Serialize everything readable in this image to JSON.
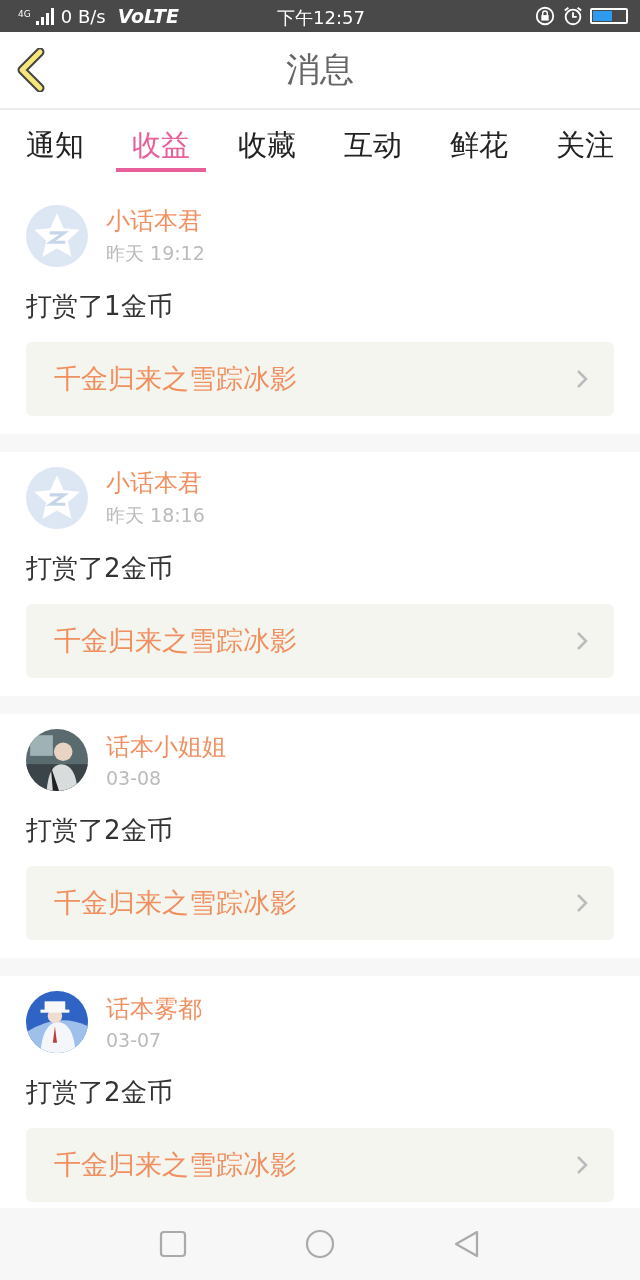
{
  "status_bar": {
    "network": "4G",
    "speed": "0 B/s",
    "volte": "VoLTE",
    "time": "下午12:57"
  },
  "header": {
    "title": "消息"
  },
  "tabs": [
    {
      "label": "通知",
      "selected": false
    },
    {
      "label": "收益",
      "selected": true
    },
    {
      "label": "收藏",
      "selected": false
    },
    {
      "label": "互动",
      "selected": false
    },
    {
      "label": "鲜花",
      "selected": false
    },
    {
      "label": "关注",
      "selected": false
    }
  ],
  "messages": [
    {
      "avatar": {
        "kind": "default"
      },
      "user": "小话本君",
      "time": "昨天 19:12",
      "text": "打赏了1金币",
      "book": "千金归来之雪踪冰影"
    },
    {
      "avatar": {
        "kind": "default"
      },
      "user": "小话本君",
      "time": "昨天 18:16",
      "text": "打赏了2金币",
      "book": "千金归来之雪踪冰影"
    },
    {
      "user": "话本小姐姐",
      "time": "03-08",
      "text": "打赏了2金币",
      "book": "千金归来之雪踪冰影"
    },
    {
      "user": "话本雾都",
      "time": "03-07",
      "text": "打赏了2金币",
      "book": "千金归来之雪踪冰影"
    }
  ]
}
